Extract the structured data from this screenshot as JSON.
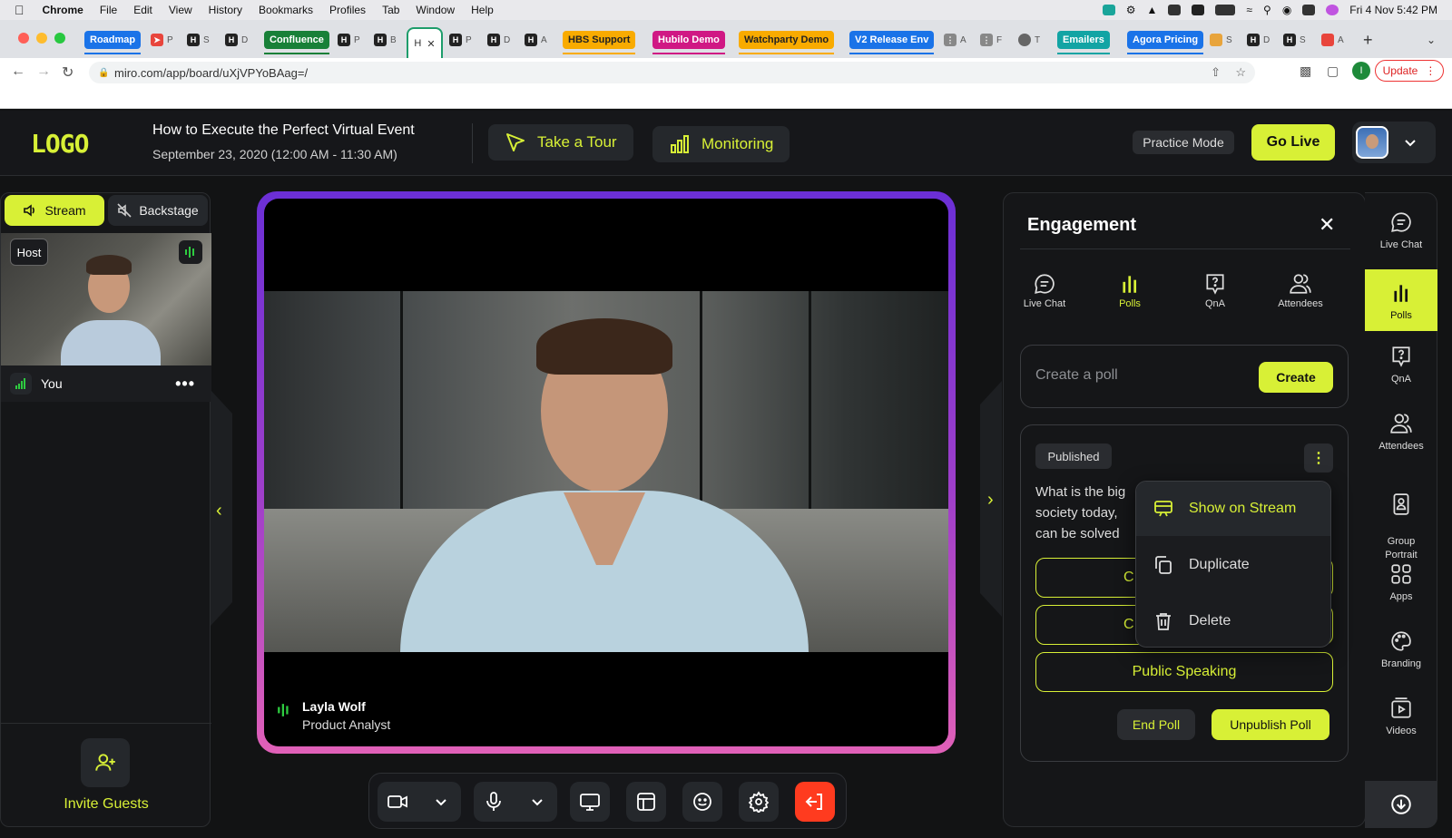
{
  "os_menubar": {
    "app": "Chrome",
    "menus": [
      "File",
      "Edit",
      "View",
      "History",
      "Bookmarks",
      "Profiles",
      "Tab",
      "Window",
      "Help"
    ],
    "clock": "Fri 4 Nov  5:42 PM"
  },
  "browser": {
    "tab_groups": [
      {
        "label": "Roadmap",
        "color": "#1a73e8"
      },
      {
        "label": "Confluence",
        "color": "#188038"
      },
      {
        "label": "HBS Support",
        "color": "#f9ab00"
      },
      {
        "label": "Hubilo Demo",
        "color": "#d01884"
      },
      {
        "label": "Watchparty Demo",
        "color": "#f9ab00"
      },
      {
        "label": "V2 Release Env",
        "color": "#1a73e8"
      },
      {
        "label": "Emailers",
        "color": "#12a4a4"
      },
      {
        "label": "Agora Pricing",
        "color": "#1a73e8"
      }
    ],
    "tab_letters": {
      "p": "P",
      "h": "H",
      "s": "S",
      "d": "D",
      "b": "B",
      "a": "A",
      "t": "T",
      "f": "F",
      "tcut": "T"
    },
    "active_tab_letter": "H",
    "url": "miro.com/app/board/uXjVPYoBAag=/",
    "update_label": "Update"
  },
  "app_header": {
    "logo_text": "LOGO",
    "event_title": "How to Execute the Perfect Virtual Event",
    "event_date": "September 23, 2020 (12:00 AM - 11:30 AM)",
    "tour_label": "Take a Tour",
    "monitoring_label": "Monitoring",
    "practice_label": "Practice Mode",
    "golive_label": "Go Live"
  },
  "left_panel": {
    "stream_tab": "Stream",
    "backstage_tab": "Backstage",
    "host_badge": "Host",
    "self_name": "You",
    "invite_label": "Invite Guests"
  },
  "stage": {
    "speaker_name": "Layla Wolf",
    "speaker_role": "Product Analyst"
  },
  "engagement": {
    "title": "Engagement",
    "tabs": [
      {
        "label": "Live Chat",
        "active": false
      },
      {
        "label": "Polls",
        "active": true
      },
      {
        "label": "QnA",
        "active": false
      },
      {
        "label": "Attendees",
        "active": false
      }
    ],
    "create_placeholder": "Create a poll",
    "create_button": "Create",
    "poll": {
      "status": "Published",
      "question_lines": [
        "What is the big",
        "society today,",
        "can be solved"
      ],
      "options": [
        {
          "text": "C"
        },
        {
          "text": "C"
        },
        {
          "text": "Public Speaking"
        }
      ],
      "end_label": "End Poll",
      "unpublish_label": "Unpublish Poll"
    },
    "menu": [
      {
        "label": "Show on Stream",
        "icon": "stream-icon",
        "highlighted": true
      },
      {
        "label": "Duplicate",
        "icon": "duplicate-icon",
        "highlighted": false
      },
      {
        "label": "Delete",
        "icon": "trash-icon",
        "highlighted": false
      }
    ]
  },
  "right_rail": [
    {
      "label": "Live Chat",
      "icon": "chat-icon",
      "active": false
    },
    {
      "label": "Polls",
      "icon": "polls-icon",
      "active": true
    },
    {
      "label": "QnA",
      "icon": "qna-icon",
      "active": false
    },
    {
      "label": "Attendees",
      "icon": "attendees-icon",
      "active": false
    },
    {
      "label": "Group\nPortrait",
      "icon": "portrait-icon",
      "active": false
    },
    {
      "label": "Apps",
      "icon": "apps-icon",
      "active": false
    },
    {
      "label": "Branding",
      "icon": "palette-icon",
      "active": false
    },
    {
      "label": "Videos",
      "icon": "video-library-icon",
      "active": false
    }
  ],
  "colors": {
    "accent": "#d8f036",
    "panel": "#151618",
    "leave": "#ff3b1f"
  }
}
